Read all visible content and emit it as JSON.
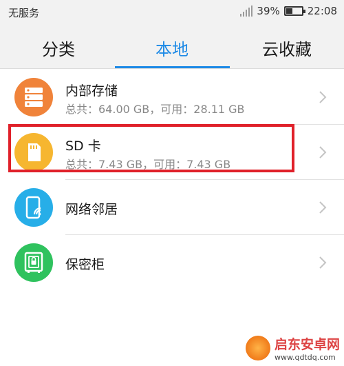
{
  "status_bar": {
    "carrier": "无服务",
    "battery_text": "39%",
    "battery_level": 0.39,
    "time": "22:08"
  },
  "tabs": [
    {
      "label": "分类",
      "active": false
    },
    {
      "label": "本地",
      "active": true
    },
    {
      "label": "云收藏",
      "active": false
    }
  ],
  "list": [
    {
      "title": "内部存储",
      "subtitle": "总共：64.00 GB，可用：28.11 GB",
      "icon": "server-icon",
      "color": "#f0833a"
    },
    {
      "title": "SD 卡",
      "subtitle": "总共：7.43 GB，可用：7.43 GB",
      "icon": "sd-card-icon",
      "color": "#f6b630"
    },
    {
      "title": "网络邻居",
      "subtitle": "",
      "icon": "phone-wifi-icon",
      "color": "#27aee8"
    },
    {
      "title": "保密柜",
      "subtitle": "",
      "icon": "safe-icon",
      "color": "#2fc25e"
    }
  ],
  "watermark": {
    "name": "启东安卓网",
    "url": "www.qdtdq.com"
  },
  "colors": {
    "accent": "#1e8ae6",
    "highlight": "#e0212a"
  }
}
